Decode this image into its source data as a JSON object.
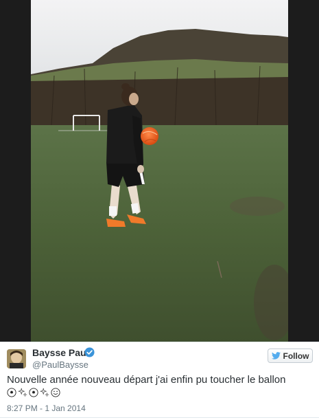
{
  "tweet": {
    "user_name": "Baysse Paul",
    "user_handle": "@PaulBaysse",
    "follow_label": "Follow",
    "text": "Nouvelle année nouveau départ j'ai enfin pu toucher le ballon",
    "emojis": [
      "soccer-ball-icon",
      "sparkles-icon",
      "soccer-ball-icon",
      "sparkles-icon",
      "smile-icon"
    ],
    "timestamp": "8:27 PM - 1 Jan 2014"
  },
  "colors": {
    "follow_bird": "#55acee",
    "verified": "#3b94d9",
    "name": "#292f33",
    "meta": "#66757f"
  }
}
